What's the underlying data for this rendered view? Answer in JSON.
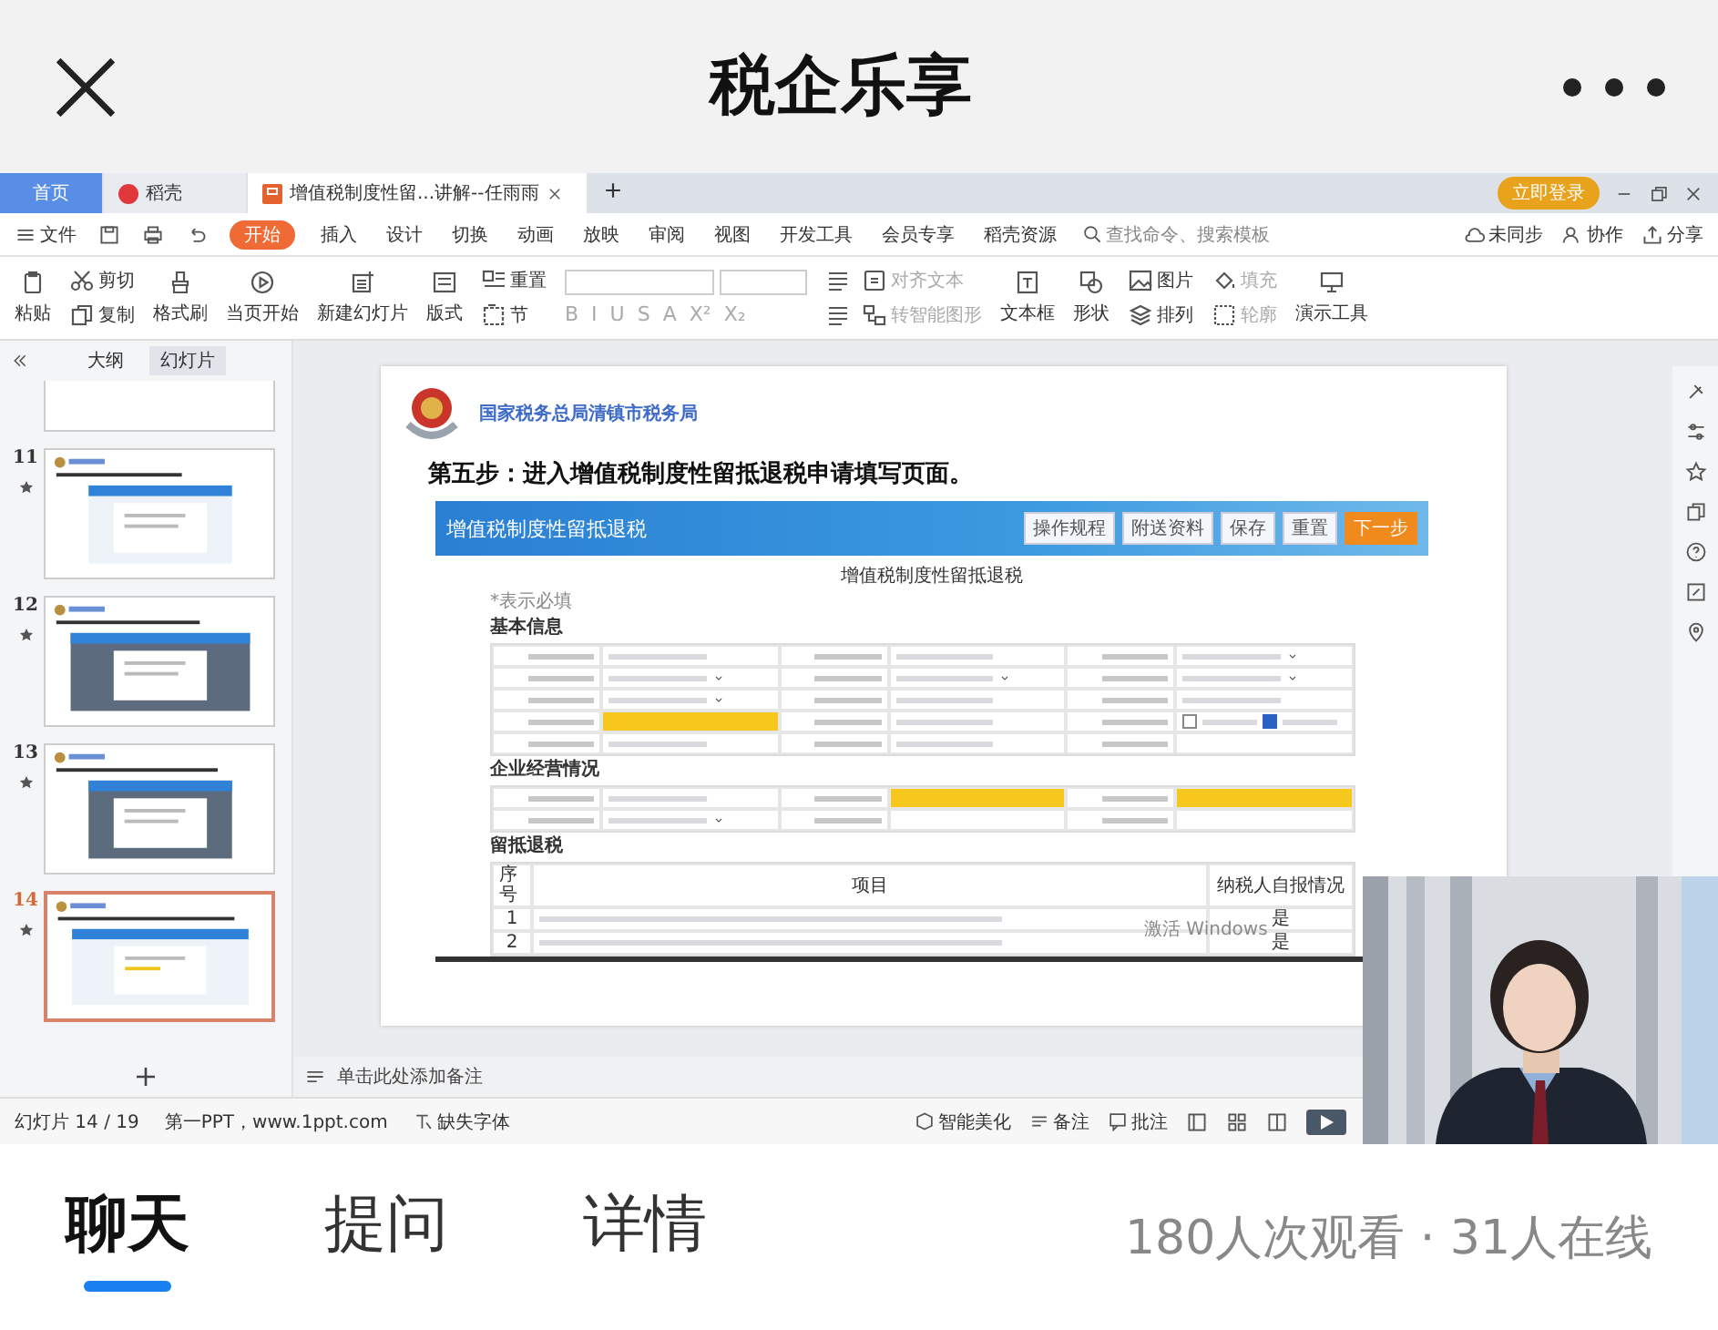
{
  "app_header": {
    "title": "税企乐享"
  },
  "wps": {
    "tabs": [
      {
        "label": "首页",
        "selected": false,
        "kind": "home"
      },
      {
        "label": "稻壳",
        "selected": false,
        "kind": "docer"
      },
      {
        "label": "增值税制度性留...讲解--任雨雨",
        "selected": true,
        "kind": "doc"
      }
    ],
    "login_button": "立即登录",
    "file_menu": "文件",
    "ribbon_tabs": [
      {
        "label": "开始",
        "selected": true
      },
      {
        "label": "插入",
        "selected": false
      },
      {
        "label": "设计",
        "selected": false
      },
      {
        "label": "切换",
        "selected": false
      },
      {
        "label": "动画",
        "selected": false
      },
      {
        "label": "放映",
        "selected": false
      },
      {
        "label": "审阅",
        "selected": false
      },
      {
        "label": "视图",
        "selected": false
      },
      {
        "label": "开发工具",
        "selected": false
      },
      {
        "label": "会员专享",
        "selected": false
      },
      {
        "label": "稻壳资源",
        "selected": false
      }
    ],
    "search": {
      "placeholder": "查找命令、搜索模板"
    },
    "sync_actions": [
      "未同步",
      "协作",
      "分享"
    ],
    "ribbon": [
      {
        "kind": "large",
        "items": [
          {
            "label": "粘贴",
            "disabled": false
          }
        ]
      },
      {
        "kind": "pair",
        "items": [
          {
            "label": "剪切",
            "disabled": false
          },
          {
            "label": "复制",
            "disabled": false
          }
        ]
      },
      {
        "kind": "large",
        "items": [
          {
            "label": "格式刷",
            "disabled": false
          }
        ]
      },
      {
        "kind": "large",
        "items": [
          {
            "label": "当页开始",
            "disabled": false
          }
        ]
      },
      {
        "kind": "large",
        "items": [
          {
            "label": "新建幻灯片",
            "disabled": false
          }
        ]
      },
      {
        "kind": "large",
        "items": [
          {
            "label": "版式",
            "disabled": false
          }
        ]
      },
      {
        "kind": "pair",
        "items": [
          {
            "label": "重置",
            "disabled": false
          },
          {
            "label": "节",
            "disabled": false
          }
        ]
      },
      {
        "kind": "font",
        "items": [
          {
            "label": "B",
            "disabled": true
          },
          {
            "label": "I",
            "disabled": true
          },
          {
            "label": "U",
            "disabled": true
          },
          {
            "label": "S",
            "disabled": true
          },
          {
            "label": "A",
            "disabled": true
          },
          {
            "label": "X²",
            "disabled": true
          },
          {
            "label": "X₂",
            "disabled": true
          }
        ]
      },
      {
        "kind": "paragraph",
        "items": [
          {
            "label": "对齐文本",
            "disabled": true
          },
          {
            "label": "转智能图形",
            "disabled": true
          }
        ]
      },
      {
        "kind": "large",
        "items": [
          {
            "label": "文本框",
            "disabled": false
          }
        ]
      },
      {
        "kind": "large",
        "items": [
          {
            "label": "形状",
            "disabled": false
          }
        ]
      },
      {
        "kind": "pair",
        "items": [
          {
            "label": "图片",
            "disabled": false
          },
          {
            "label": "排列",
            "disabled": false
          }
        ]
      },
      {
        "kind": "pair",
        "items": [
          {
            "label": "填充",
            "disabled": true
          },
          {
            "label": "轮廓",
            "disabled": true
          }
        ]
      },
      {
        "kind": "large",
        "items": [
          {
            "label": "演示工具",
            "disabled": false
          }
        ]
      }
    ],
    "outline_tabs": [
      {
        "label": "大纲",
        "selected": false
      },
      {
        "label": "幻灯片",
        "selected": true
      }
    ],
    "slides": [
      {
        "kind": "partial",
        "selected": false
      },
      {
        "kind": "full",
        "number": "11",
        "selected": false
      },
      {
        "kind": "full",
        "number": "12",
        "selected": false
      },
      {
        "kind": "full",
        "number": "13",
        "selected": false
      },
      {
        "kind": "full",
        "number": "14",
        "selected": true
      }
    ],
    "slide": {
      "org": "国家税务总局清镇市税务局",
      "title": "第五步：进入增值税制度性留抵退税申请填写页面。",
      "form": {
        "banner_title": "增值税制度性留抵退税",
        "buttons": [
          {
            "label": "操作规程",
            "kind": "normal"
          },
          {
            "label": "附送资料",
            "kind": "normal"
          },
          {
            "label": "保存",
            "kind": "normal"
          },
          {
            "label": "重置",
            "kind": "normal"
          },
          {
            "label": "下一步",
            "kind": "primary"
          }
        ],
        "title": "增值税制度性留抵退税",
        "required_note": "*表示必填",
        "sections": [
          {
            "heading": "基本信息",
            "rows": [
              {
                "cells": [
                  {
                    "kind": "text"
                  },
                  {
                    "kind": "text"
                  },
                  {
                    "kind": "select"
                  }
                ]
              },
              {
                "cells": [
                  {
                    "kind": "select"
                  },
                  {
                    "kind": "select"
                  },
                  {
                    "kind": "select"
                  }
                ]
              },
              {
                "cells": [
                  {
                    "kind": "select"
                  },
                  {
                    "kind": "text"
                  },
                  {
                    "kind": "text"
                  }
                ]
              },
              {
                "cells": [
                  {
                    "kind": "highlight"
                  },
                  {
                    "kind": "text"
                  },
                  {
                    "kind": "checkboxes",
                    "checks": [
                      false,
                      true
                    ]
                  }
                ]
              },
              {
                "cells": [
                  {
                    "kind": "text"
                  },
                  {
                    "kind": "text"
                  },
                  {
                    "kind": "empty"
                  }
                ]
              }
            ]
          },
          {
            "heading": "企业经营情况",
            "rows": [
              {
                "cells": [
                  {
                    "kind": "text"
                  },
                  {
                    "kind": "highlight"
                  },
                  {
                    "kind": "highlight"
                  }
                ]
              },
              {
                "cells": [
                  {
                    "kind": "select"
                  },
                  {
                    "kind": "empty"
                  },
                  {
                    "kind": "empty"
                  }
                ]
              }
            ]
          },
          {
            "heading": "留抵退税",
            "table": {
              "columns": [
                "序号",
                "项目",
                "纳税人自报情况"
              ],
              "rows": [
                {
                  "number": "1",
                  "answer": "是"
                },
                {
                  "number": "2",
                  "answer": "是"
                }
              ]
            }
          }
        ]
      }
    },
    "os_notice": "激活 Windows",
    "notes_placeholder": "单击此处添加备注",
    "status_bar": {
      "left": [
        "幻灯片 14 / 19",
        "第一PPT，www.1ppt.com",
        "缺失字体"
      ],
      "right": [
        "智能美化",
        "备注",
        "批注"
      ]
    }
  },
  "bottom_tabs": [
    {
      "label": "聊天",
      "selected": true
    },
    {
      "label": "提问",
      "selected": false
    },
    {
      "label": "详情",
      "selected": false
    }
  ],
  "viewer_stats": "180人次观看 · 31人在线"
}
